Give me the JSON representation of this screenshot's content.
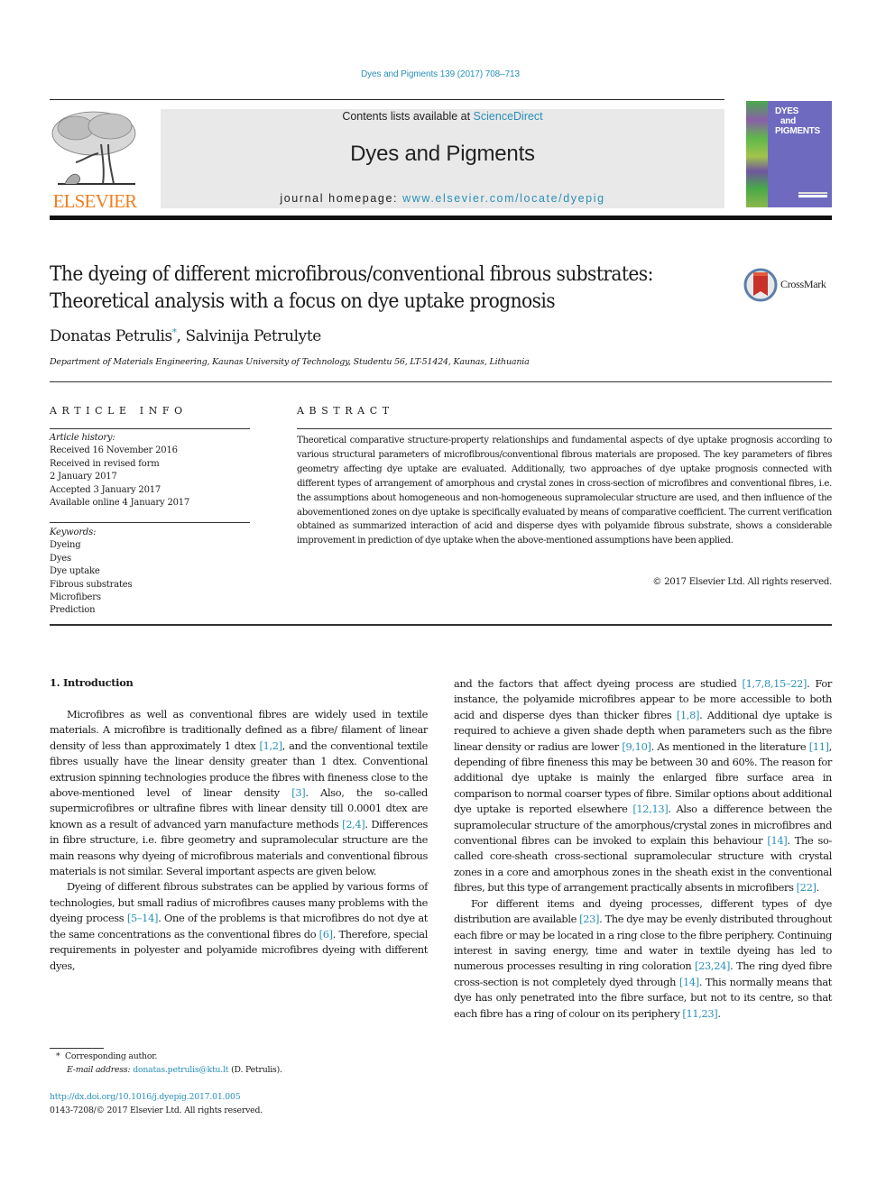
{
  "header": {
    "citation": "Dyes and Pigments 139 (2017) 708–713",
    "contents_prefix": "Contents lists available at ",
    "contents_link": "ScienceDirect",
    "journal_name": "Dyes and Pigments",
    "homepage_prefix": "journal homepage: ",
    "homepage_link": "www.elsevier.com/locate/dyepig",
    "publisher_logo_text": "ELSEVIER",
    "cover": {
      "title_line1": "DYES",
      "title_line2": "and",
      "title_line3": "PIGMENTS",
      "bg_color": "#6e6ac0"
    },
    "accent_color": "#2a8fb8",
    "elsevier_orange": "#f07f20"
  },
  "article": {
    "title_line1": "The dyeing of different microfibrous/conventional fibrous substrates:",
    "title_line2": "Theoretical analysis with a focus on dye uptake prognosis",
    "crossmark_label": "CrossMark",
    "author1": "Donatas Petrulis",
    "author1_marker": "*",
    "author_separator": ", ",
    "author2": "Salvinija Petrulyte",
    "affiliation": "Department of Materials Engineering, Kaunas University of Technology, Studentu 56, LT-51424, Kaunas, Lithuania"
  },
  "article_info": {
    "label": "ARTICLE INFO",
    "history_heading": "Article history:",
    "history": [
      "Received 16 November 2016",
      "Received in revised form",
      "2 January 2017",
      "Accepted 3 January 2017",
      "Available online 4 January 2017"
    ],
    "keywords_heading": "Keywords:",
    "keywords": [
      "Dyeing",
      "Dyes",
      "Dye uptake",
      "Fibrous substrates",
      "Microfibers",
      "Prediction"
    ]
  },
  "abstract": {
    "label": "ABSTRACT",
    "text": "Theoretical comparative structure-property relationships and fundamental aspects of dye uptake prog­nosis according to various structural parameters of microfibrous/conventional fibrous materials are proposed. The key parameters of fibres geometry affecting dye uptake are evaluated. Additionally, two approaches of dye uptake prognosis connected with different types of arrangement of amorphous and crystal zones in cross-section of microfibres and conventional fibres, i.e. the assumptions about homo­geneous and non-homogeneous supramolecular structure are used, and then influence of the above­mentioned zones on dye uptake is specifically evaluated by means of comparative coefficient. The cur­rent verification obtained as summarized interaction of acid and disperse dyes with polyamide fibrous substrate, shows a considerable improvement in prediction of dye uptake when the above-mentioned assumptions have been applied.",
    "copyright": "© 2017 Elsevier Ltd. All rights reserved."
  },
  "body": {
    "intro_heading": "1.  Introduction",
    "left_paragraphs": [
      [
        {
          "t": "Microfibres as well as conventional fibres are widely used in textile materials. A microfibre is traditionally defined as a fibre/ filament of linear density of less than approximately 1 dtex "
        },
        {
          "ref": "[1,2]"
        },
        {
          "t": ", and the conventional textile fibres usually have the linear density greater than 1 dtex. Conventional extrusion spinning technologies produce the fibres with fineness close to the above-mentioned level of linear density "
        },
        {
          "ref": "[3]"
        },
        {
          "t": ". Also, the so-called supermicrofibres or ultra­fine fibres with linear density till 0.0001 dtex are known as a result of advanced yarn manufacture methods "
        },
        {
          "ref": "[2,4]"
        },
        {
          "t": ". Differences in fibre structure, i.e. fibre geometry and supramolecular structure are the main reasons why dyeing of microfibrous materials and con­ventional fibrous materials is not similar. Several important aspects are given below."
        }
      ],
      [
        {
          "t": "Dyeing of different fibrous substrates can be applied by various forms of technologies, but small radius of microfibres causes many problems with the dyeing process "
        },
        {
          "ref": "[5–14]"
        },
        {
          "t": ". One of the problems is that microfibres do not dye at the same concentrations as the conventional fibres do "
        },
        {
          "ref": "[6]"
        },
        {
          "t": ". Therefore, special requirements in polyester and polyamide microfibres dyeing with different dyes,"
        }
      ]
    ],
    "right_paragraphs": [
      [
        {
          "t": "and the factors that affect dyeing process are studied "
        },
        {
          "ref": "[1,7,8,15–22]"
        },
        {
          "t": ". For instance, the polyamide microfibres appear to be more acces­sible to both acid and disperse dyes than thicker fibres "
        },
        {
          "ref": "[1,8]"
        },
        {
          "t": ". Additional dye uptake is required to achieve a given shade depth when parameters such as the fibre linear density or radius are lower "
        },
        {
          "ref": "[9,10]"
        },
        {
          "t": ". As mentioned in the literature "
        },
        {
          "ref": "[11]"
        },
        {
          "t": ", depending of fibre fineness this may be between 30 and 60%. The reason for additional dye uptake is mainly the enlarged fibre surface area in comparison to normal coarser types of fibre. Similar options about additional dye uptake is reported elsewhere "
        },
        {
          "ref": "[12,13]"
        },
        {
          "t": ". Also a difference between the supramolecular structure of the amorphous/crystal zones in microfibres and conventional fibres can be invoked to explain this behaviour "
        },
        {
          "ref": "[14]"
        },
        {
          "t": ". The so-called core-sheath cross-sectional supra­molecular structure with crystal zones in a core and amorphous zones in the sheath exist in the conventional fibres, but this type of arrangement practically absents in microfibers "
        },
        {
          "ref": "[22]"
        },
        {
          "t": "."
        }
      ],
      [
        {
          "t": "For different items and dyeing processes, different types of dye distribution are available "
        },
        {
          "ref": "[23]"
        },
        {
          "t": ". The dye may be evenly distributed throughout each fibre or may be located in a ring close to the fibre periphery. Continuing interest in saving energy, time and water in textile dyeing has led to numerous processes resulting in ring coloration "
        },
        {
          "ref": "[23,24]"
        },
        {
          "t": ". The ring dyed fibre cross-section is not completely dyed through "
        },
        {
          "ref": "[14]"
        },
        {
          "t": ". This normally means that dye has only penetrated into the fibre surface, but not to its centre, so that each fibre has a ring of colour on its periphery "
        },
        {
          "ref": "[11,23]"
        },
        {
          "t": "."
        }
      ]
    ]
  },
  "footnotes": {
    "corresponding_marker": "*",
    "corresponding_text": "Corresponding author.",
    "email_label": "E-mail address:",
    "email": "donatas.petrulis@ktu.lt",
    "email_suffix": " (D. Petrulis).",
    "doi": "http://dx.doi.org/10.1016/j.dyepig.2017.01.005",
    "issn_line": "0143-7208/© 2017 Elsevier Ltd. All rights reserved."
  }
}
